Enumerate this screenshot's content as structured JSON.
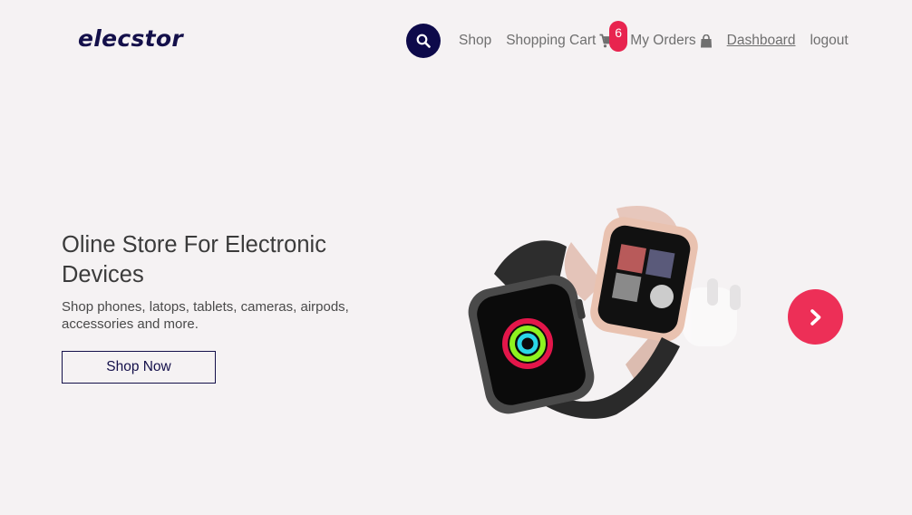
{
  "brand": {
    "logo_text": "elecstor"
  },
  "nav": {
    "search_icon": "search-icon",
    "shop_label": "Shop",
    "cart_label": "Shopping Cart",
    "cart_icon": "cart-icon",
    "cart_count": "6",
    "orders_label": "My Orders",
    "orders_icon": "shopping-bag-icon",
    "dashboard_label": "Dashboard",
    "logout_label": "logout"
  },
  "hero": {
    "title": "Oline Store For Electronic Devices",
    "subtitle": "Shop phones, latops, tablets, cameras, airpods, accessories and more.",
    "cta_label": "Shop Now",
    "next_icon": "chevron-right-icon"
  },
  "colors": {
    "brand": "#14104a",
    "accent": "#ed2f57",
    "background": "#f5f2f3"
  }
}
